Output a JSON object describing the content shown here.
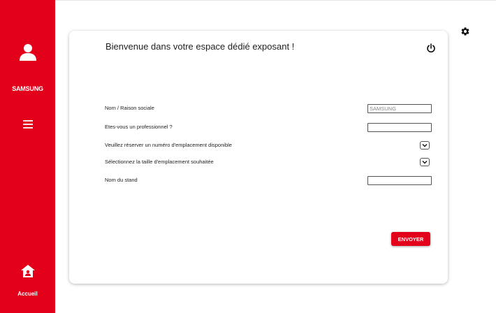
{
  "sidebar": {
    "user_icon": "user-icon",
    "company": "SAMSUNG",
    "menu_icon": "menu-icon",
    "home_icon": "home-icon",
    "home_label": "Accueil",
    "color": "#e3001b"
  },
  "settings_icon": "gear-icon",
  "card": {
    "title": "Bienvenue dans votre espace dédié exposant !",
    "power_icon": "power-icon",
    "fields": {
      "name": {
        "label": "Nom / Raison sociale",
        "value": "SAMSUNG"
      },
      "professional": {
        "label": "Etes-vous un professionnel ?",
        "value": ""
      },
      "slot": {
        "label": "Veuillez réserver un numéro d'emplacement disponible"
      },
      "size": {
        "label": "Sélectionnez la taille d'emplacement souhaitée"
      },
      "stand": {
        "label": "Nom du stand",
        "value": ""
      }
    },
    "submit_label": "ENVOYER"
  }
}
